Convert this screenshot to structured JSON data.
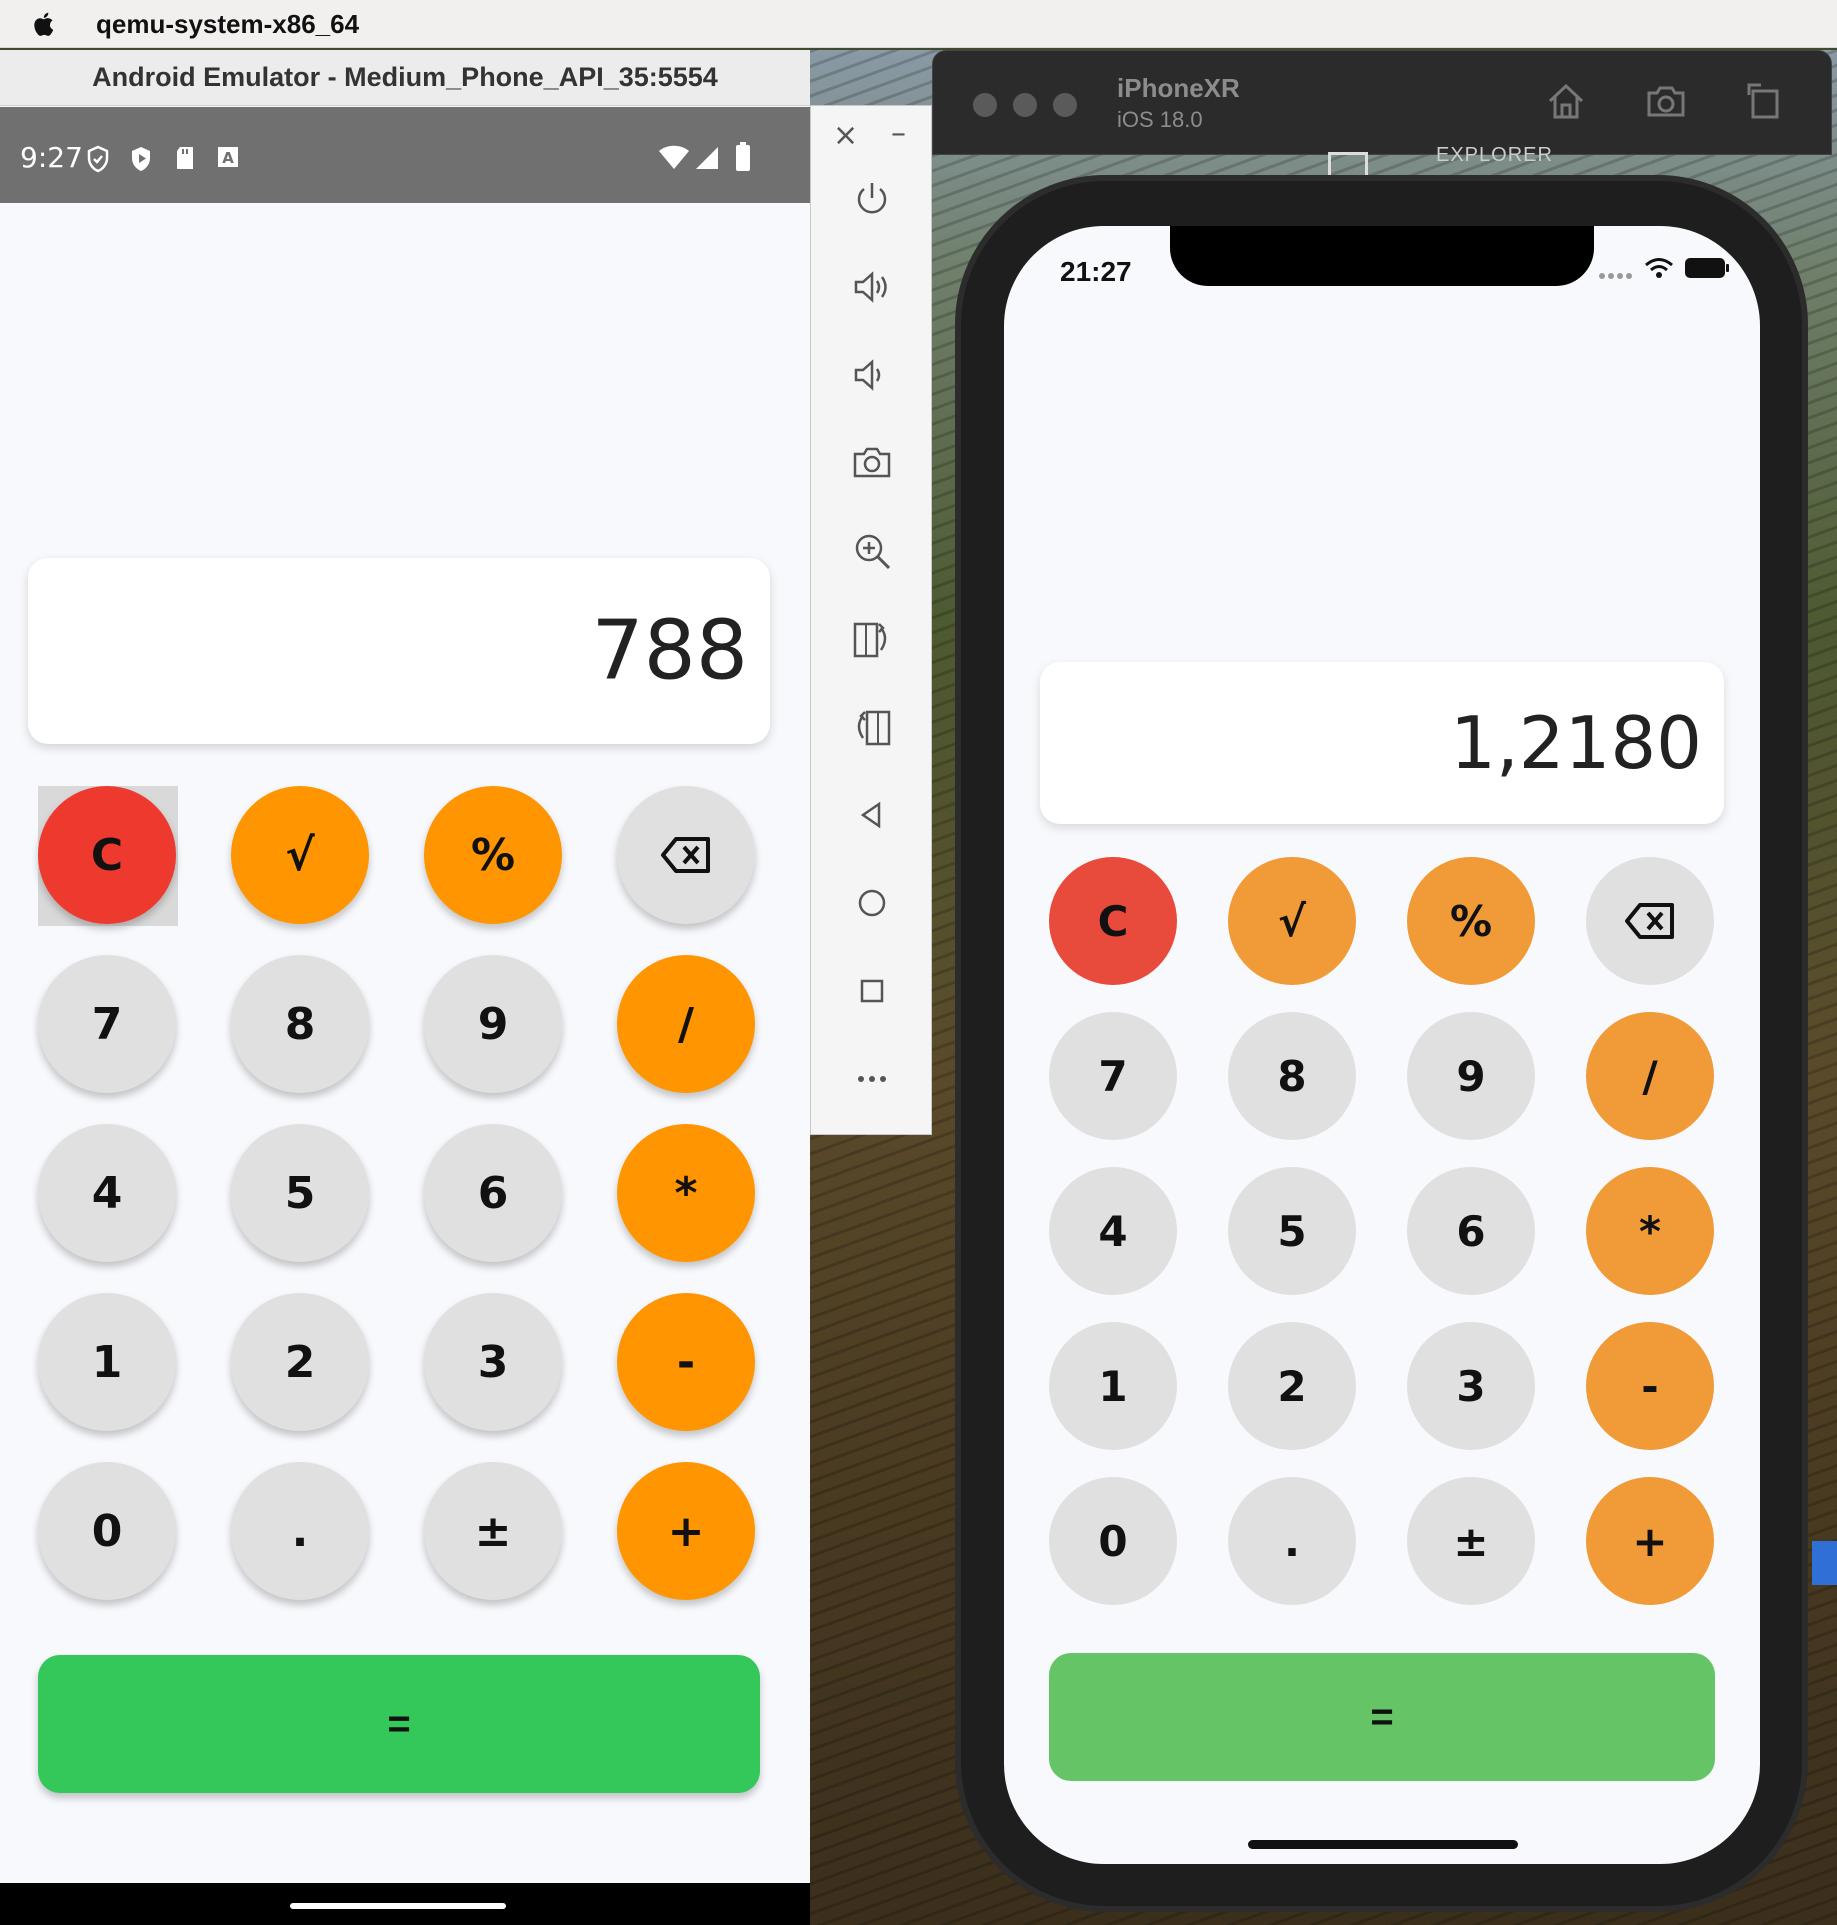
{
  "menubar": {
    "app_name": "qemu-system-x86_64"
  },
  "android": {
    "window_title": "Android Emulator - Medium_Phone_API_35:5554",
    "status_time": "9:27",
    "display_value": "788",
    "buttons": [
      [
        "C",
        "√",
        "%",
        "⌫"
      ],
      [
        "7",
        "8",
        "9",
        "/"
      ],
      [
        "4",
        "5",
        "6",
        "*"
      ],
      [
        "1",
        "2",
        "3",
        "-"
      ],
      [
        "0",
        ".",
        "±",
        "+"
      ]
    ],
    "equals_label": "=",
    "colors": {
      "orange": "#ff9500",
      "red": "#ee3a2e",
      "gray": "#e0e0e0",
      "green": "#34c759"
    }
  },
  "emulator_toolbar": {
    "close": "×",
    "minimize": "–",
    "icons": [
      "power-icon",
      "volume-up-icon",
      "volume-down-icon",
      "camera-icon",
      "zoom-icon",
      "rotate-left-icon",
      "rotate-right-icon",
      "back-icon",
      "home-icon",
      "overview-icon",
      "more-icon"
    ]
  },
  "simulator": {
    "device_name": "iPhoneXR",
    "os_version": "iOS 18.0",
    "behind_text": "EXPLORER",
    "status_time": "21:27",
    "display_value": "1,2180",
    "buttons": [
      [
        "C",
        "√",
        "%",
        "⌫"
      ],
      [
        "7",
        "8",
        "9",
        "/"
      ],
      [
        "4",
        "5",
        "6",
        "*"
      ],
      [
        "1",
        "2",
        "3",
        "-"
      ],
      [
        "0",
        ".",
        "±",
        "+"
      ]
    ],
    "equals_label": "=",
    "colors": {
      "orange": "#f19a38",
      "red": "#e84b3c",
      "gray": "#e0e0e0",
      "green": "#65c466"
    }
  }
}
